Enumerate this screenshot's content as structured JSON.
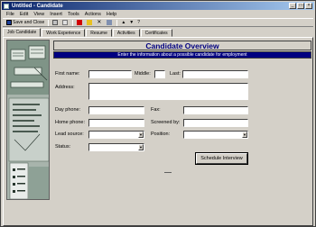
{
  "window": {
    "title": "Untitled - Candidate"
  },
  "menu": [
    "File",
    "Edit",
    "View",
    "Insert",
    "Tools",
    "Actions",
    "Help"
  ],
  "toolbar": {
    "save_close": "Save and Close"
  },
  "tabs": [
    "Job Candidate",
    "Work Experience",
    "Resume",
    "Activities",
    "Certificates"
  ],
  "form": {
    "header": "Candidate Overview",
    "subheader": "Enter the information about a possible candidate for employment",
    "first_name": "First name:",
    "middle": "Middle:",
    "last": "Last:",
    "address": "Address:",
    "day_phone": "Day phone:",
    "fax": "Fax:",
    "home_phone": "Home phone:",
    "screened_by": "Screened by:",
    "lead_source": "Lead source:",
    "position": "Position:",
    "status": "Status:",
    "schedule_button": "Schedule Interview"
  }
}
